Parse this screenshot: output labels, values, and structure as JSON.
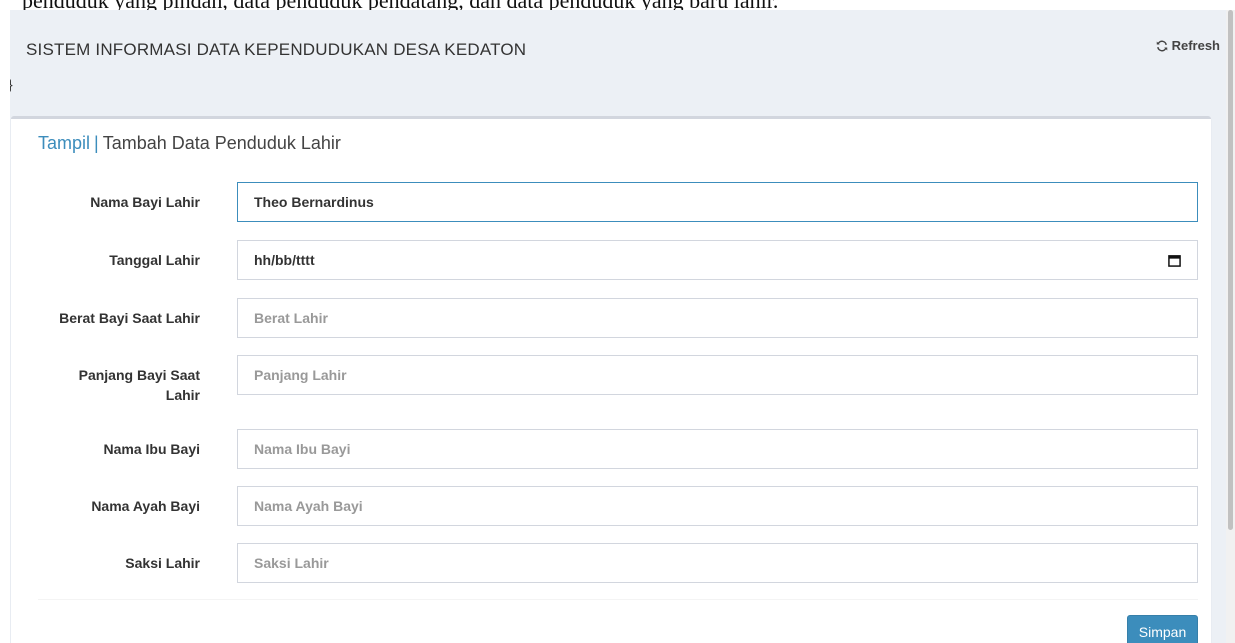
{
  "page": {
    "top_text": "penduduk yang pindah, data penduduk pendatang, dan data penduduk yang baru lahir."
  },
  "header": {
    "title": "SISTEM INFORMASI DATA KEPENDUDUKAN DESA KEDATON",
    "refresh_label": "Refresh",
    "brace": "}"
  },
  "box": {
    "title_link": "Tampil",
    "title_sep": "|",
    "title_text": "Tambah Data Penduduk Lahir"
  },
  "form": {
    "fields": [
      {
        "label": "Nama Bayi Lahir",
        "value": "Theo Bernardinus",
        "placeholder": ""
      },
      {
        "label": "Tanggal Lahir",
        "value": "hh/bb/tttt",
        "placeholder": ""
      },
      {
        "label": "Berat Bayi Saat Lahir",
        "value": "",
        "placeholder": "Berat Lahir"
      },
      {
        "label": "Panjang Bayi Saat Lahir",
        "value": "",
        "placeholder": "Panjang Lahir"
      },
      {
        "label": "Nama Ibu Bayi",
        "value": "",
        "placeholder": "Nama Ibu Bayi"
      },
      {
        "label": "Nama Ayah Bayi",
        "value": "",
        "placeholder": "Nama Ayah Bayi"
      },
      {
        "label": "Saksi Lahir",
        "value": "",
        "placeholder": "Saksi Lahir"
      }
    ],
    "submit_label": "Simpan"
  },
  "icons": {
    "refresh": "refresh-icon",
    "calendar": "calendar-icon"
  },
  "colors": {
    "accent": "#3c8dbc",
    "background": "#ecf0f5"
  }
}
